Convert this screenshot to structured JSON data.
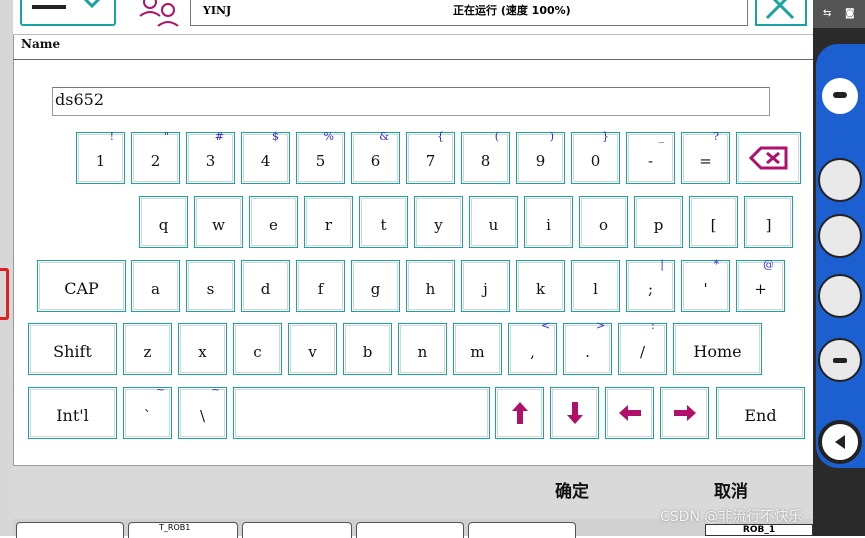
{
  "status": {
    "name": "YINJ",
    "run_text": "正在运行 (速度 100%)"
  },
  "field": {
    "label": "Name",
    "value": "ds652"
  },
  "keys_row1": [
    {
      "main": "1",
      "shift": "!"
    },
    {
      "main": "2",
      "shift": "\""
    },
    {
      "main": "3",
      "shift": "#"
    },
    {
      "main": "4",
      "shift": "$"
    },
    {
      "main": "5",
      "shift": "%"
    },
    {
      "main": "6",
      "shift": "&"
    },
    {
      "main": "7",
      "shift": "{"
    },
    {
      "main": "8",
      "shift": "("
    },
    {
      "main": "9",
      "shift": ")"
    },
    {
      "main": "0",
      "shift": "}"
    },
    {
      "main": "-",
      "shift": "_"
    },
    {
      "main": "=",
      "shift": "?"
    }
  ],
  "keys_row2": [
    "q",
    "w",
    "e",
    "r",
    "t",
    "y",
    "u",
    "i",
    "o",
    "p",
    "[",
    "]"
  ],
  "keys_row3": [
    {
      "main": "CAP",
      "shift": ""
    },
    {
      "main": "a",
      "shift": ""
    },
    {
      "main": "s",
      "shift": ""
    },
    {
      "main": "d",
      "shift": ""
    },
    {
      "main": "f",
      "shift": ""
    },
    {
      "main": "g",
      "shift": ""
    },
    {
      "main": "h",
      "shift": ""
    },
    {
      "main": "j",
      "shift": ""
    },
    {
      "main": "k",
      "shift": ""
    },
    {
      "main": "l",
      "shift": ""
    },
    {
      "main": ";",
      "shift": "|"
    },
    {
      "main": "'",
      "shift": "*"
    },
    {
      "main": "+",
      "shift": "@"
    }
  ],
  "keys_row4": [
    {
      "main": "Shift",
      "shift": ""
    },
    {
      "main": "z",
      "shift": ""
    },
    {
      "main": "x",
      "shift": ""
    },
    {
      "main": "c",
      "shift": ""
    },
    {
      "main": "v",
      "shift": ""
    },
    {
      "main": "b",
      "shift": ""
    },
    {
      "main": "n",
      "shift": ""
    },
    {
      "main": "m",
      "shift": ""
    },
    {
      "main": ",",
      "shift": "<"
    },
    {
      "main": ".",
      "shift": ">"
    },
    {
      "main": "/",
      "shift": ":"
    },
    {
      "main": "Home",
      "shift": ""
    }
  ],
  "keys_row5": {
    "intl": "Int'l",
    "backtick": "`",
    "backtick_shift": "~",
    "backslash": "\\",
    "backslash_shift": "~",
    "end": "End"
  },
  "buttons": {
    "ok": "确定",
    "cancel": "取消"
  },
  "taskbar": {
    "tab2": "T_ROB1",
    "rob": "ROB_1"
  },
  "watermark": "CSDN @非流行不快乐",
  "colors": {
    "key_border": "#1aa3a3",
    "shift_char": "#2a2ad0",
    "backspace": "#b0106a"
  },
  "icons": [
    "menu-icon",
    "chevron-down-icon",
    "user-icon",
    "close-icon",
    "backspace-icon",
    "arrow-up-icon",
    "arrow-down-icon",
    "arrow-left-icon",
    "arrow-right-icon"
  ]
}
